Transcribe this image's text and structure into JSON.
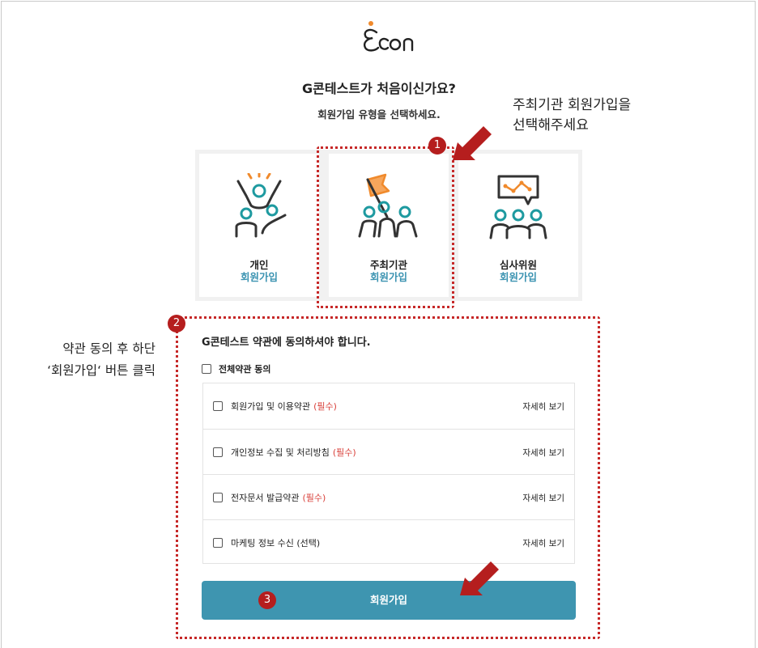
{
  "brand": {
    "logo_text": "econ"
  },
  "header": {
    "title": "G콘테스트가 처음이신가요?",
    "subtitle": "회원가입 유형을 선택하세요."
  },
  "annotations": {
    "hint_select_line1": "주최기관 회원가입을",
    "hint_select_line2": "선택해주세요",
    "hint_agree_line1": "약관 동의 후 하단",
    "hint_agree_line2": "‘회원가입‘ 버튼 클릭",
    "badge1": "1",
    "badge2": "2",
    "badge3": "3",
    "highlight_color": "#c62828",
    "arrow_color": "#b51e1e"
  },
  "signup_types": [
    {
      "title": "개인",
      "subtitle": "회원가입",
      "icon": "individual-cheer-icon"
    },
    {
      "title": "주최기관",
      "subtitle": "회원가입",
      "icon": "organizer-flag-icon"
    },
    {
      "title": "심사위원",
      "subtitle": "회원가입",
      "icon": "judge-presentation-icon"
    }
  ],
  "terms": {
    "title": "G콘테스트 약관에 동의하셔야 합니다.",
    "agree_all": "전체약관 동의",
    "items": [
      {
        "label": "회원가입 및 이용약관",
        "badge": "(필수)",
        "link": "자세히 보기"
      },
      {
        "label": "개인정보 수집 및 처리방침",
        "badge": "(필수)",
        "link": "자세히 보기"
      },
      {
        "label": "전자문서 발급약관",
        "badge": "(필수)",
        "link": "자세히 보기"
      },
      {
        "label": "마케팅 정보 수신 (선택)",
        "badge": "",
        "link": "자세히 보기"
      }
    ]
  },
  "submit": {
    "label": "회원가입"
  },
  "colors": {
    "accent": "#3e95b0",
    "accent_text": "#3b93b1",
    "required": "#d9413b",
    "icon_orange": "#f08a2c",
    "icon_teal": "#1e9aa0"
  }
}
